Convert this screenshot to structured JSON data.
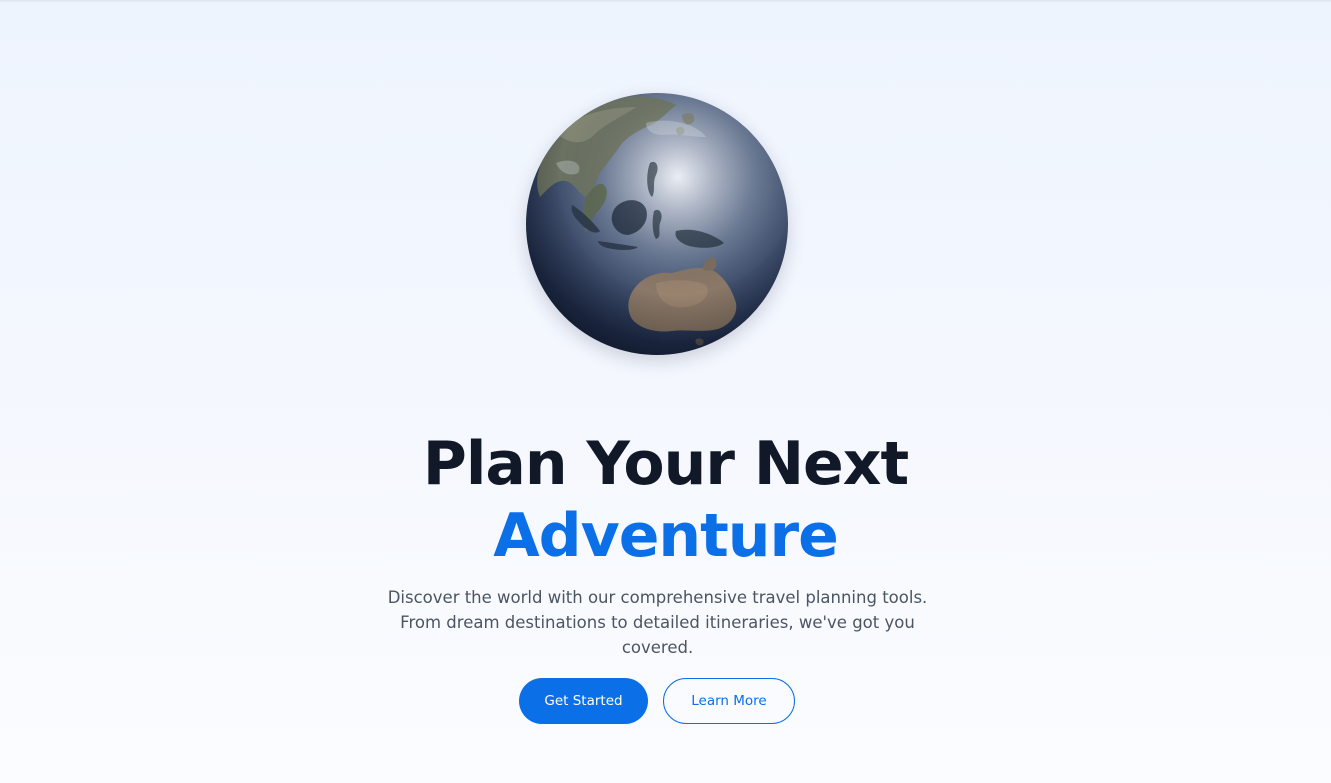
{
  "hero": {
    "title_line1": "Plan Your Next",
    "title_line2": "Adventure",
    "subtitle": "Discover the world with our comprehensive travel planning tools. From dream destinations to detailed itineraries, we've got you covered.",
    "primary_cta": "Get Started",
    "secondary_cta": "Learn More",
    "globe_icon": "globe-icon"
  },
  "colors": {
    "accent": "#0b6fe8",
    "heading": "#111827",
    "body_text": "#4b5563",
    "background": "#eef4fe"
  }
}
